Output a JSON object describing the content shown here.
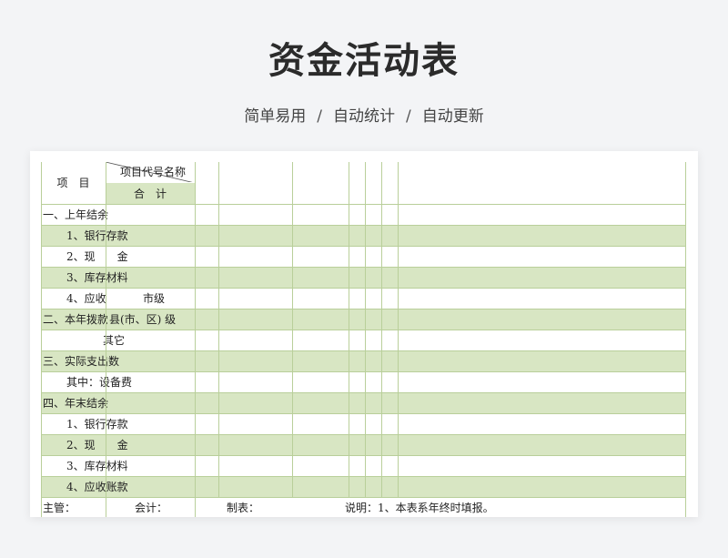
{
  "title": "资金活动表",
  "subtitle": {
    "parts": [
      "简单易用",
      "自动统计",
      "自动更新"
    ],
    "sep": "/"
  },
  "table": {
    "header": {
      "item": "项　目",
      "code_name": "项目代号名称",
      "total": "合　计"
    },
    "rows": [
      {
        "label": "一、上年结余",
        "indent": 0
      },
      {
        "label": "1、银行存款",
        "indent": 1
      },
      {
        "label": "2、现　　金",
        "indent": 1
      },
      {
        "label": "3、库存材料",
        "indent": 1
      },
      {
        "label": "4、应收",
        "indent": 1,
        "sub": "市级"
      },
      {
        "label": "二、本年拨款",
        "indent": 0,
        "sub": "县(市、区) 级"
      },
      {
        "label": "其它",
        "indent": 2
      },
      {
        "label": "三、实际支出数",
        "indent": 0
      },
      {
        "label": "其中：设备费",
        "indent": 1
      },
      {
        "label": "四、年末结余",
        "indent": 0
      },
      {
        "label": "1、银行存款",
        "indent": 1
      },
      {
        "label": "2、现　　金",
        "indent": 1
      },
      {
        "label": "3、库存材料",
        "indent": 1
      },
      {
        "label": "4、应收账款",
        "indent": 1
      }
    ],
    "footer": {
      "manager": "主管：",
      "accountant": "会计：",
      "maker": "制表：",
      "note": "说明：1、本表系年终时填报。"
    }
  }
}
